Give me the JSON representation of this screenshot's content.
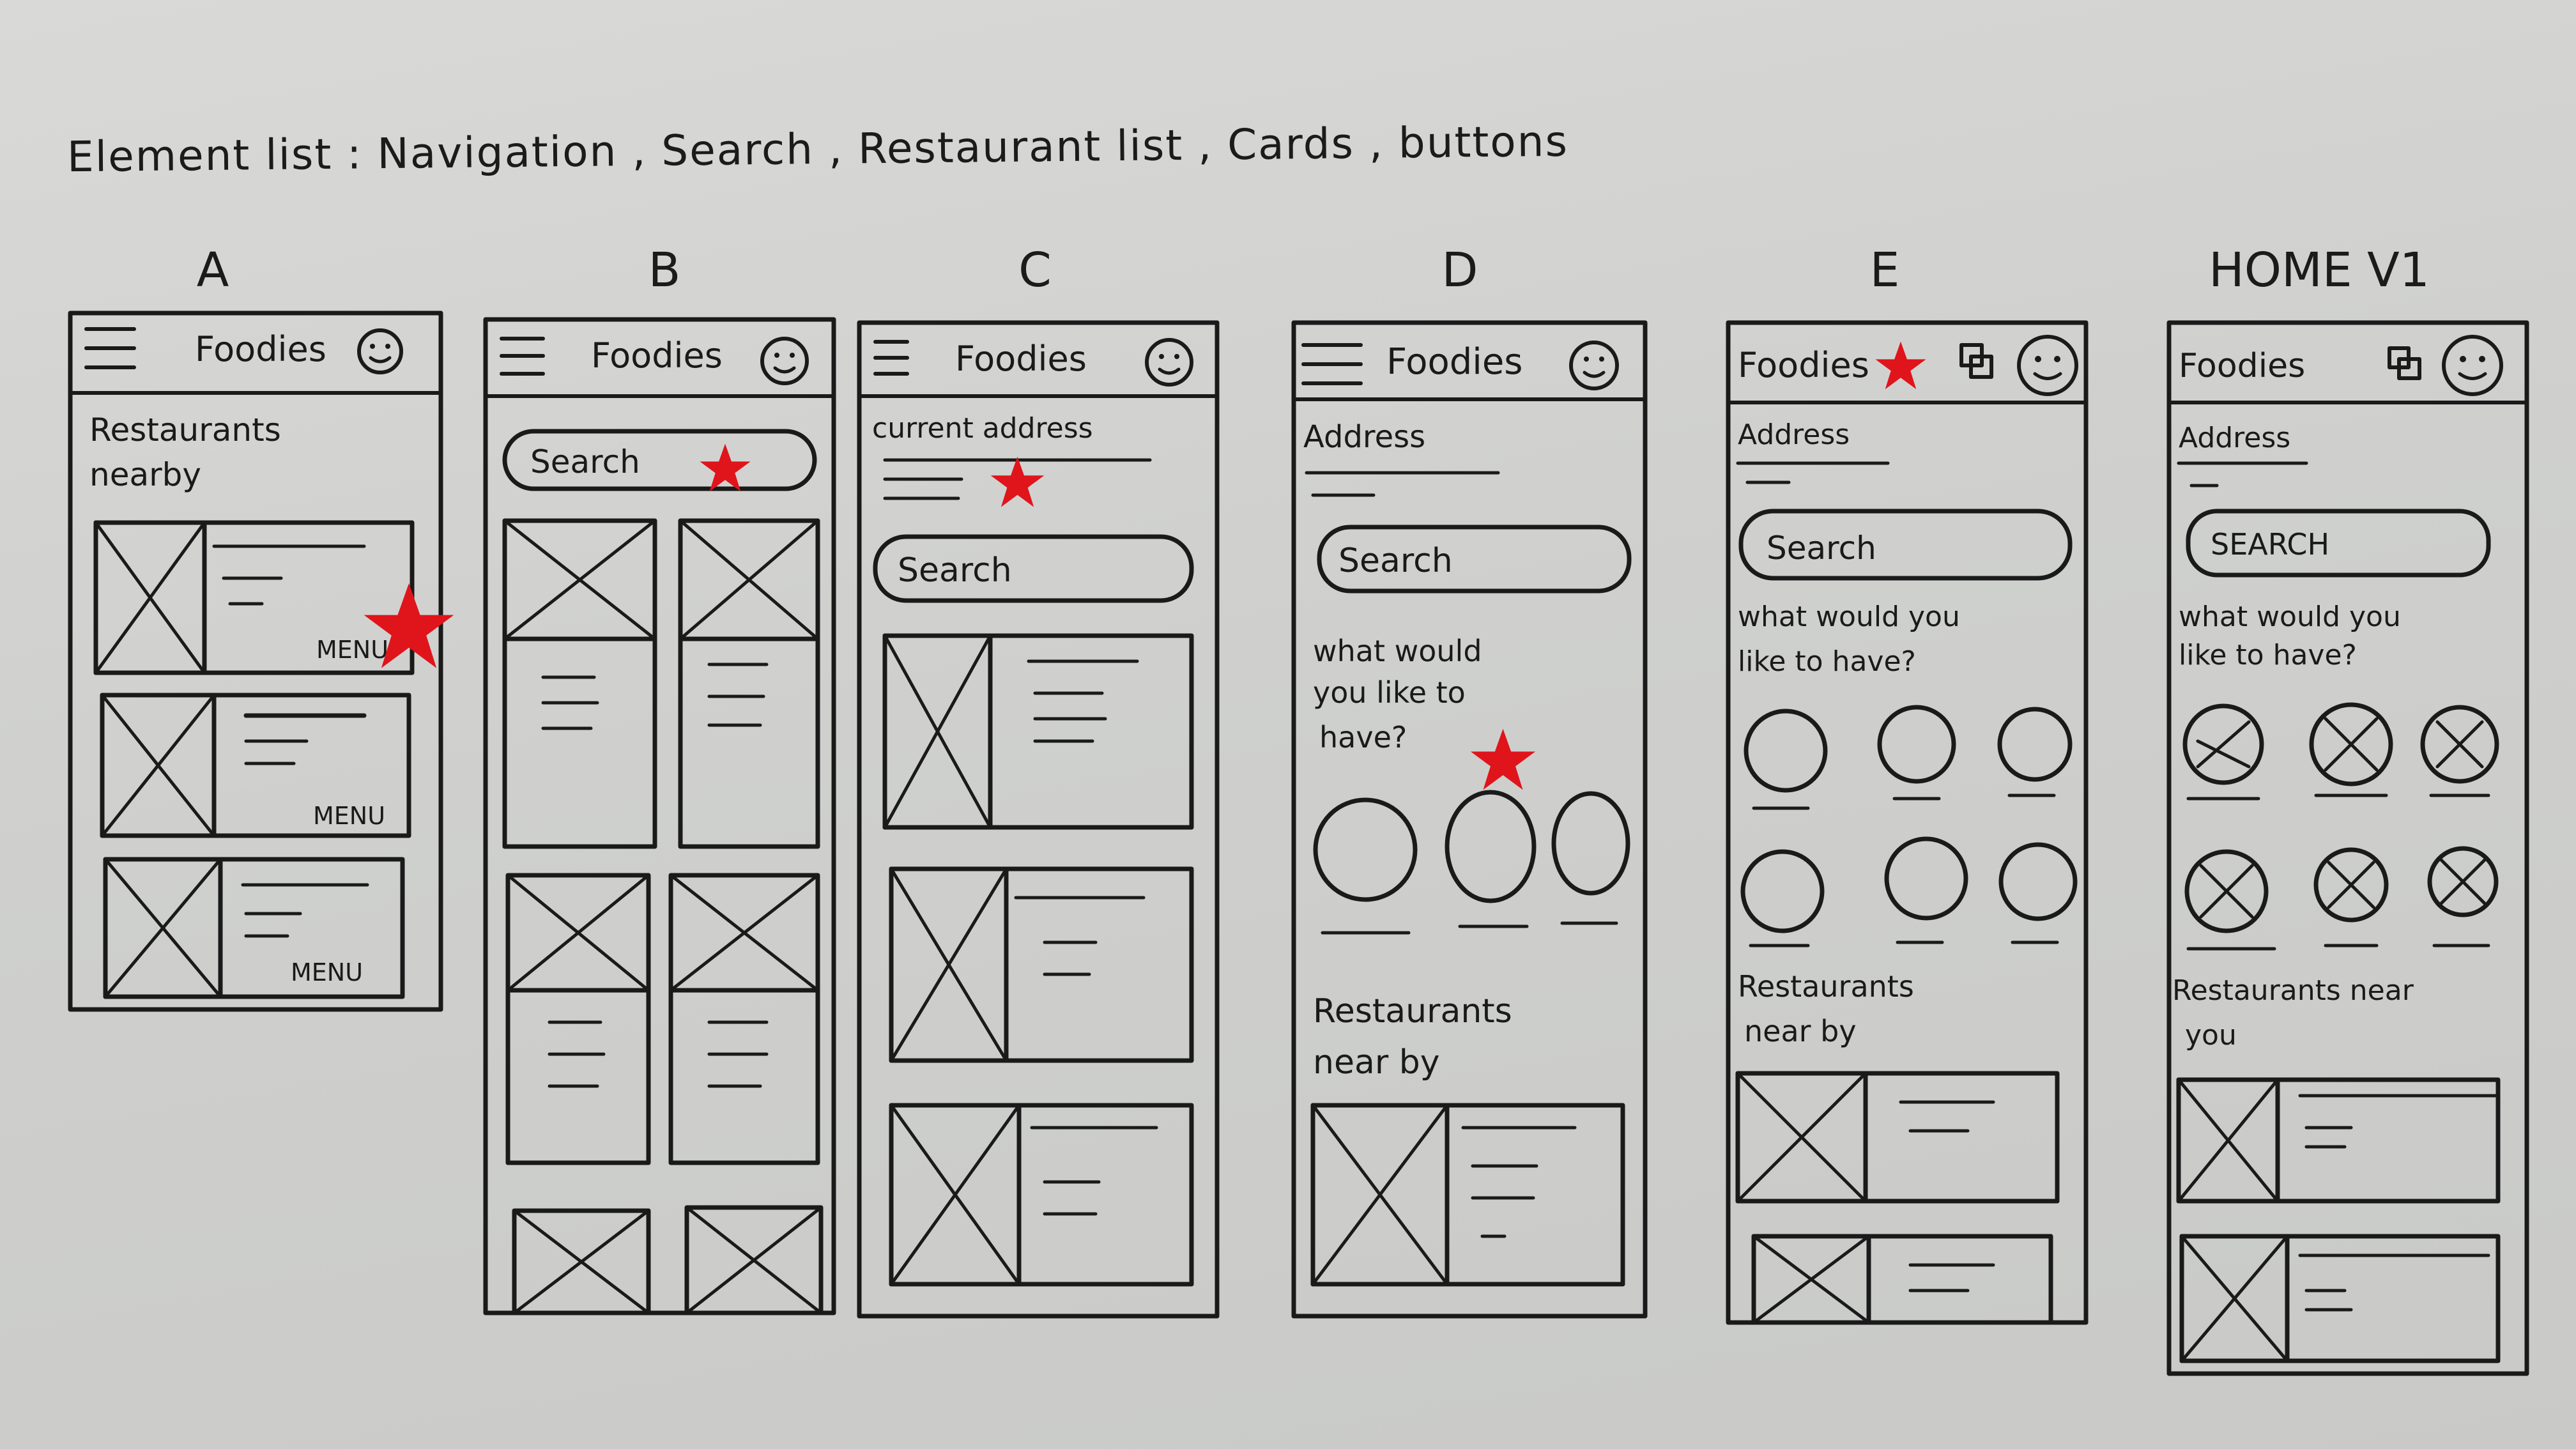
{
  "header": {
    "element_list": "Element list : Navigation , Search , Restaurant list , Cards , buttons"
  },
  "columns": [
    {
      "label": "A",
      "app_title": "Foodies",
      "section": "Restaurants nearby",
      "card_button": "MENU"
    },
    {
      "label": "B",
      "app_title": "Foodies",
      "search": "Search"
    },
    {
      "label": "C",
      "app_title": "Foodies",
      "address": "current address",
      "search": "Search"
    },
    {
      "label": "D",
      "app_title": "Foodies",
      "address": "Address",
      "search": "Search",
      "prompt": "what would you like to have?",
      "section": "Restaurants near by"
    },
    {
      "label": "E",
      "app_title": "Foodies",
      "address": "Address",
      "search": "Search",
      "prompt": "what would you like to have?",
      "section": "Restaurants near by"
    },
    {
      "label": "HOME V1",
      "app_title": "Foodies",
      "address": "Address",
      "search": "SEARCH",
      "prompt": "what would you like to have?",
      "section": "Restaurants near you"
    }
  ],
  "colors": {
    "paper": "#d2d3d1",
    "ink": "#1a1a1a",
    "highlight_star": "#e0141b"
  },
  "icons": [
    "hamburger-icon",
    "smiley-profile-icon",
    "cart-icon",
    "star-mark-icon",
    "image-placeholder-icon"
  ]
}
